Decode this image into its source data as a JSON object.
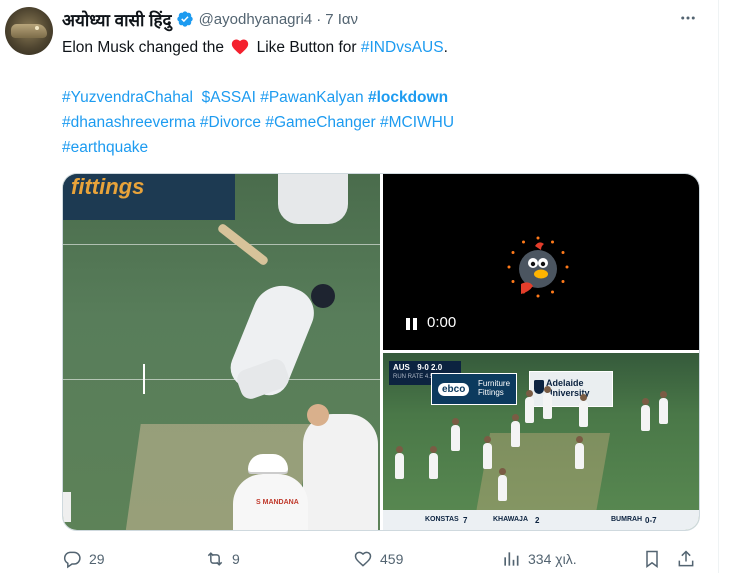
{
  "tweet": {
    "author": {
      "display_name": "अयोध्या वासी हिंदु",
      "handle": "@ayodhyanagri4",
      "verified": true
    },
    "time": "7 Ιαν",
    "text": {
      "line1_before": "Elon Musk changed the ",
      "line1_after": " Like Button for ",
      "line1_tag": "#INDvsAUS",
      "line1_end": ".",
      "hashtags_line2": [
        "#YuzvendraChahal",
        "$ASSAI",
        "#PawanKalyan",
        "#lockdown"
      ],
      "hashtags_line3": [
        "#dhanashreeverma",
        "#Divorce",
        "#GameChanger",
        "#MCIWHU"
      ],
      "hashtags_line4": [
        "#earthquake"
      ]
    },
    "media": {
      "left_banner": "fittings",
      "umpire_shirt": "S MANDANA",
      "video_time": "0:00",
      "scoreboard": {
        "team": "AUS",
        "score": "9-0",
        "overs": "2.0",
        "sub": "RUN RATE 4.50"
      },
      "ad_left_brand": "ebco",
      "ad_left_text": "Furniture Fittings",
      "ad_right_text": "Adelaide University",
      "ticker": {
        "batter1": "KONSTAS",
        "batter1_runs": "7",
        "batter2": "KHAWAJA",
        "batter2_runs": "2",
        "bowler": "BUMRAH",
        "bowler_figures": "0-7"
      }
    },
    "actions": {
      "replies": "29",
      "reposts": "9",
      "likes": "459",
      "views": "334 χιλ."
    }
  },
  "colors": {
    "link": "#1d9bf0",
    "muted": "#536471",
    "heart": "#f4212e",
    "verified": "#1d9bf0"
  },
  "icons": [
    "more-icon",
    "verified-badge-icon",
    "heart-emoji-icon",
    "reply-icon",
    "repost-icon",
    "like-icon",
    "views-icon",
    "bookmark-icon",
    "share-icon",
    "pause-icon",
    "loading-spinner-icon"
  ]
}
